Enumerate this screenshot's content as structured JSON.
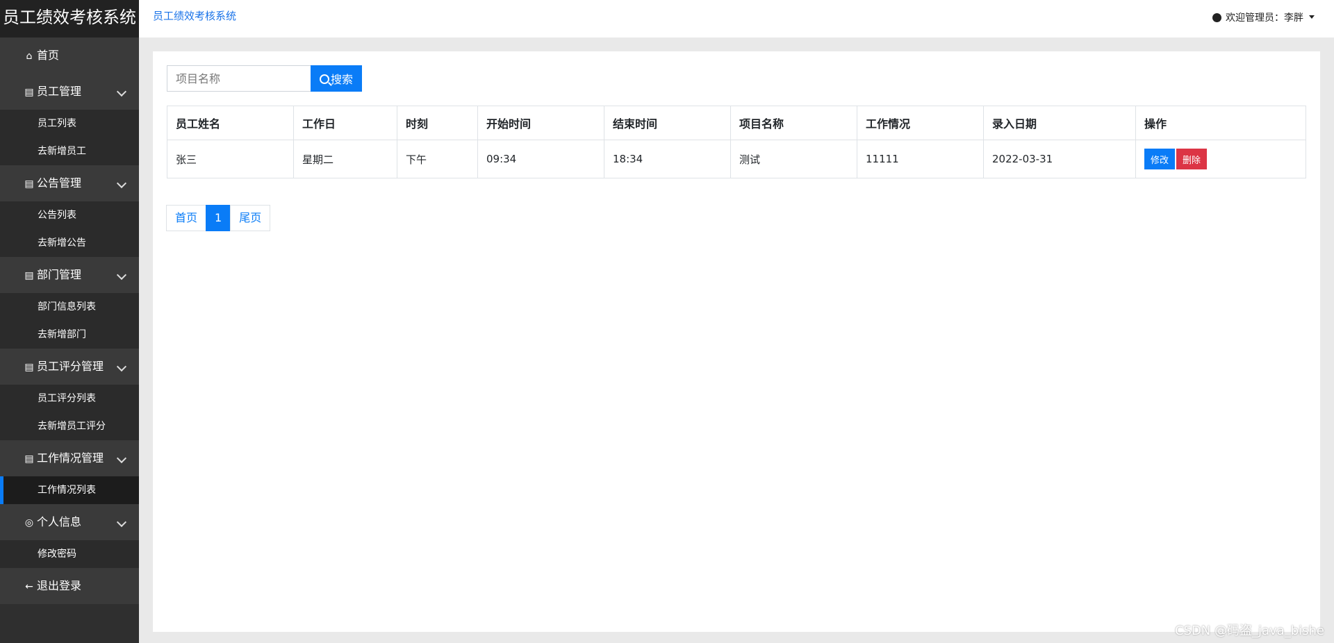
{
  "brand": "员工绩效考核系统",
  "breadcrumb": "员工绩效考核系统",
  "user": {
    "greeting": "欢迎管理员：李胖"
  },
  "sidebar": {
    "home": "首页",
    "groups": [
      {
        "label": "员工管理",
        "items": [
          "员工列表",
          "去新增员工"
        ]
      },
      {
        "label": "公告管理",
        "items": [
          "公告列表",
          "去新增公告"
        ]
      },
      {
        "label": "部门管理",
        "items": [
          "部门信息列表",
          "去新增部门"
        ]
      },
      {
        "label": "员工评分管理",
        "items": [
          "员工评分列表",
          "去新增员工评分"
        ]
      },
      {
        "label": "工作情况管理",
        "items": [
          "工作情况列表"
        ]
      },
      {
        "label": "个人信息",
        "items": [
          "修改密码"
        ]
      }
    ],
    "logout": "退出登录",
    "active_item": "工作情况列表"
  },
  "search": {
    "placeholder": "项目名称",
    "button": "搜索"
  },
  "table": {
    "headers": [
      "员工姓名",
      "工作日",
      "时刻",
      "开始时间",
      "结束时间",
      "项目名称",
      "工作情况",
      "录入日期",
      "操作"
    ],
    "rows": [
      {
        "name": "张三",
        "weekday": "星期二",
        "period": "下午",
        "start": "09:34",
        "end": "18:34",
        "project": "测试",
        "status": "11111",
        "date": "2022-03-31"
      }
    ],
    "edit_label": "修改",
    "delete_label": "删除"
  },
  "pagination": {
    "first": "首页",
    "current": "1",
    "last": "尾页"
  },
  "watermark": "CSDN @码盗_java_bishe",
  "colors": {
    "accent": "#0a7cf7",
    "danger": "#dc3545",
    "sidebar": "#2f2f2f"
  }
}
